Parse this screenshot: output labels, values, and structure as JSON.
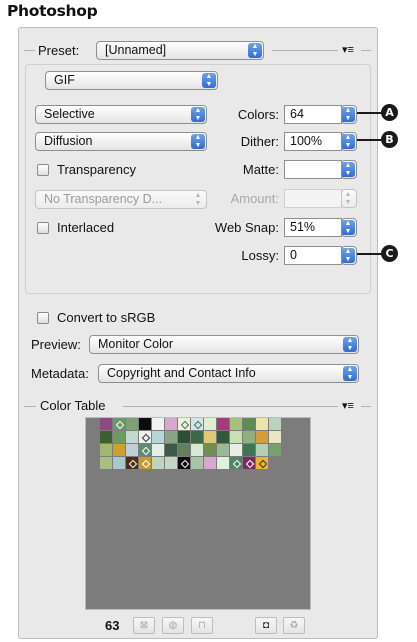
{
  "app_title": "Photoshop",
  "preset": {
    "label": "Preset:",
    "value": "[Unnamed]",
    "menu_icon": "▾≡"
  },
  "format": {
    "value": "GIF"
  },
  "reduction": {
    "value": "Selective"
  },
  "dither_algo": {
    "value": "Diffusion"
  },
  "transparency": {
    "label": "Transparency",
    "checked": false
  },
  "transparency_dither": {
    "value": "No Transparency D...",
    "disabled": true
  },
  "interlaced": {
    "label": "Interlaced",
    "checked": false
  },
  "colors": {
    "label": "Colors:",
    "value": "64"
  },
  "dither": {
    "label": "Dither:",
    "value": "100%"
  },
  "matte": {
    "label": "Matte:",
    "value": ""
  },
  "amount": {
    "label": "Amount:",
    "value": "",
    "disabled": true
  },
  "web_snap": {
    "label": "Web Snap:",
    "value": "51%"
  },
  "lossy": {
    "label": "Lossy:",
    "value": "0"
  },
  "callouts": [
    "A",
    "B",
    "C"
  ],
  "convert_srgb": {
    "label": "Convert to sRGB",
    "checked": false
  },
  "preview": {
    "label": "Preview:",
    "value": "Monitor Color"
  },
  "metadata": {
    "label": "Metadata:",
    "value": "Copyright and Contact Info"
  },
  "color_table": {
    "title": "Color Table",
    "menu_icon": "▾≡",
    "count": "63",
    "background": "#7c7c7c",
    "swatches": [
      {
        "c": "#8d4a82"
      },
      {
        "c": "#6a9a6c",
        "m": "#ffffff"
      },
      {
        "c": "#7f9f74"
      },
      {
        "c": "#0d0d0d"
      },
      {
        "c": "#f2f2f2"
      },
      {
        "c": "#d7a8cc"
      },
      {
        "c": "#eaf3dc",
        "m": "#556655"
      },
      {
        "c": "#cfe6e8",
        "m": "#556655"
      },
      {
        "c": "#deefd0"
      },
      {
        "c": "#a33c78"
      },
      {
        "c": "#a7c07c"
      },
      {
        "c": "#5e8c52"
      },
      {
        "c": "#e8e6a8"
      },
      {
        "c": "#b9d4bc"
      },
      {
        "c": "#3e5f34"
      },
      {
        "c": "#6e9a5e"
      },
      {
        "c": "#c2d8d0"
      },
      {
        "c": "#f0f0f0",
        "m": "#333333"
      },
      {
        "c": "#b7d6d8"
      },
      {
        "c": "#8aa48a"
      },
      {
        "c": "#2d4e34"
      },
      {
        "c": "#3c6a48"
      },
      {
        "c": "#dfc878"
      },
      {
        "c": "#2f5a3a"
      },
      {
        "c": "#c9e0b4"
      },
      {
        "c": "#8fb07f"
      },
      {
        "c": "#d49c3a"
      },
      {
        "c": "#e7e7c8"
      },
      {
        "c": "#9fb86d"
      },
      {
        "c": "#cda12e"
      },
      {
        "c": "#bfcfd8"
      },
      {
        "c": "#5e8a72",
        "m": "#ffffff"
      },
      {
        "c": "#e4f0e6"
      },
      {
        "c": "#3c5a4a"
      },
      {
        "c": "#61805c"
      },
      {
        "c": "#d8e8d4"
      },
      {
        "c": "#6e8e52"
      },
      {
        "c": "#9ab89a"
      },
      {
        "c": "#e8f0e4"
      },
      {
        "c": "#3f7552"
      },
      {
        "c": "#b5d0b5"
      },
      {
        "c": "#77a26e"
      },
      {
        "c": "#a8be82"
      },
      {
        "c": "#a6c9cb"
      },
      {
        "c": "#4d2f16",
        "m": "#ffffff"
      },
      {
        "c": "#c89a2e",
        "m": "#ffffff"
      },
      {
        "c": "#bed4bf"
      },
      {
        "c": "#c1d7c4"
      },
      {
        "c": "#0c0c0c",
        "m": "#ffffff"
      },
      {
        "c": "#a8c4a6"
      },
      {
        "c": "#d9a6d2"
      },
      {
        "c": "#dff0de"
      },
      {
        "c": "#4f8562",
        "m": "#ffffff"
      },
      {
        "c": "#7a2a62",
        "m": "#ffffff"
      },
      {
        "c": "#e6b72a",
        "m": "#333333"
      },
      {
        "c": "#7c7c7c"
      }
    ],
    "toolbar_icons": [
      "web-shift-icon",
      "web-snap-icon",
      "lock-icon",
      "new-color-icon",
      "trash-icon"
    ]
  }
}
